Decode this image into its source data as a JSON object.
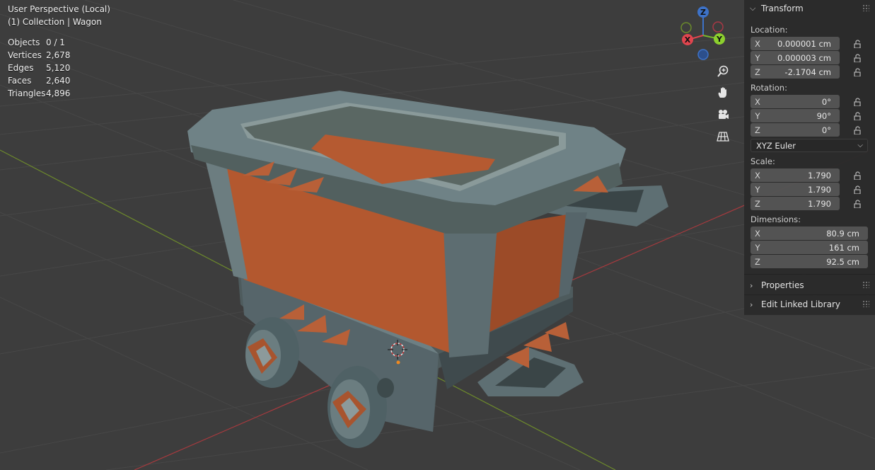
{
  "viewport": {
    "perspective_label": "User Perspective (Local)",
    "collection_label": "(1) Collection | Wagon",
    "stats": [
      {
        "key": "Objects",
        "value": "0 / 1"
      },
      {
        "key": "Vertices",
        "value": "2,678"
      },
      {
        "key": "Edges",
        "value": "5,120"
      },
      {
        "key": "Faces",
        "value": "2,640"
      },
      {
        "key": "Triangles",
        "value": "4,896"
      }
    ],
    "gizmo": {
      "x_label": "X",
      "y_label": "Y",
      "z_label": "Z"
    },
    "nav_buttons": [
      "zoom-icon",
      "pan-hand-icon",
      "camera-icon",
      "ortho-grid-icon"
    ],
    "colors": {
      "background": "#3d3d3d",
      "grid": "#474747",
      "x_axis": "#a63a3e",
      "y_axis": "#6d8a2c",
      "wood": "#b3582f",
      "metal": "#59686a"
    }
  },
  "panel": {
    "transform_title": "Transform",
    "location_label": "Location:",
    "location": [
      {
        "axis": "X",
        "value": "0.000001 cm"
      },
      {
        "axis": "Y",
        "value": "0.000003 cm"
      },
      {
        "axis": "Z",
        "value": "-2.1704 cm"
      }
    ],
    "rotation_label": "Rotation:",
    "rotation": [
      {
        "axis": "X",
        "value": "0°"
      },
      {
        "axis": "Y",
        "value": "90°"
      },
      {
        "axis": "Z",
        "value": "0°"
      }
    ],
    "rotation_mode": "XYZ Euler",
    "scale_label": "Scale:",
    "scale": [
      {
        "axis": "X",
        "value": "1.790"
      },
      {
        "axis": "Y",
        "value": "1.790"
      },
      {
        "axis": "Z",
        "value": "1.790"
      }
    ],
    "dimensions_label": "Dimensions:",
    "dimensions": [
      {
        "axis": "X",
        "value": "80.9 cm"
      },
      {
        "axis": "Y",
        "value": "161 cm"
      },
      {
        "axis": "Z",
        "value": "92.5 cm"
      }
    ],
    "properties_title": "Properties",
    "linked_library_title": "Edit Linked Library"
  }
}
